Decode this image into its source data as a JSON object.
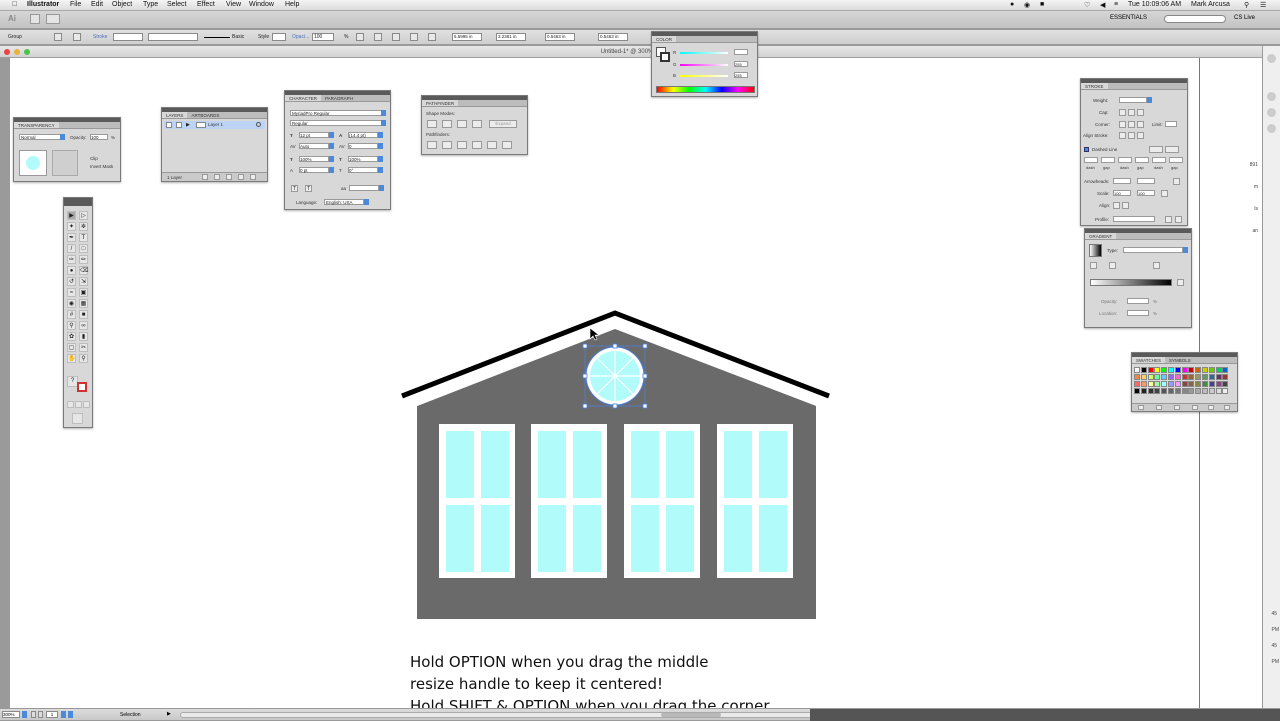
{
  "menubar": {
    "app": "Illustrator",
    "items": [
      "File",
      "Edit",
      "Object",
      "Type",
      "Select",
      "Effect",
      "View",
      "Window",
      "Help"
    ],
    "clock": "Tue 10:09:06 AM",
    "user": "Mark Arcusa"
  },
  "appbar": {
    "workspace": "ESSENTIALS",
    "cs_live": "CS Live"
  },
  "controlbar": {
    "selection": "Group",
    "stroke_label": "Stroke",
    "brush": "Basic",
    "style_label": "Style",
    "opacity_label": "Opaci...",
    "opacity_value": "100",
    "opacity_unit": "%",
    "x_value": "5.5995 in",
    "y_value": "3.2361 in",
    "w_value": "0.5463 in",
    "h_value": "0.5463 in"
  },
  "document": {
    "title": "Untitled-1* @ 300% (R"
  },
  "panels": {
    "transparency": {
      "title": "TRANSPARENCY",
      "mode": "Normal",
      "opacity_label": "Opacity:",
      "opacity": "100",
      "unit": "%",
      "clip": "Clip",
      "invert": "Invert Mask"
    },
    "layers": {
      "tabs": [
        "LAYERS",
        "ARTBOARDS"
      ],
      "layer": "Layer 1",
      "count": "1 Layer"
    },
    "character": {
      "tabs": [
        "CHARACTER",
        "PARAGRAPH"
      ],
      "font": "MyriadPro Regular",
      "style": "Regular",
      "size": "12 pt",
      "leading": "(14.4 pt)",
      "tracking": "Auto",
      "kerning": "0",
      "hscale": "100%",
      "vscale": "100%",
      "baseline": "0 pt",
      "rotation": "0°",
      "aa": "aa",
      "language_label": "Language:",
      "language": "English: USA"
    },
    "pathfinder": {
      "title": "PATHFINDER",
      "shape_modes": "Shape Modes:",
      "expand": "Expand",
      "pathfinders": "Pathfinders:"
    },
    "color": {
      "title": "COLOR",
      "channels": [
        "R",
        "G",
        "B"
      ],
      "values": [
        "",
        "255",
        "255"
      ]
    },
    "stroke": {
      "title": "STROKE",
      "weight": "Weight:",
      "cap": "Cap:",
      "corner": "Corner:",
      "limit": "Limit:",
      "align": "Align Stroke:",
      "dashed": "Dashed Line",
      "dash_cells": [
        "dash",
        "gap",
        "dash",
        "gap",
        "dash",
        "gap"
      ],
      "arrowheads": "Arrowheads:",
      "scale": "Scale:",
      "scale_a": "100",
      "scale_b": "100",
      "align2": "Align:",
      "profile": "Profile:"
    },
    "gradient": {
      "title": "GRADIENT",
      "type": "Type:",
      "opacity": "Opacity:",
      "location": "Location:",
      "unit": "%"
    },
    "swatches": {
      "tabs": [
        "SWATCHES",
        "SYMBOLS"
      ]
    }
  },
  "statusbar": {
    "zoom": "300%",
    "page": "1",
    "tool": "Selection"
  },
  "instructions": [
    "Hold OPTION when you drag the middle",
    "resize handle to keep it centered!",
    "Hold SHIFT & OPTION when you drag the corner"
  ],
  "right_edge_labels": [
    "891",
    "m",
    "ls",
    "an",
    "ard",
    "45",
    "PM",
    "45",
    "PM",
    "PM"
  ],
  "colors": {
    "house": "#6a6a6a",
    "window": "#b2fbfb",
    "selection": "#4a7fd8",
    "roof": "#000000"
  }
}
